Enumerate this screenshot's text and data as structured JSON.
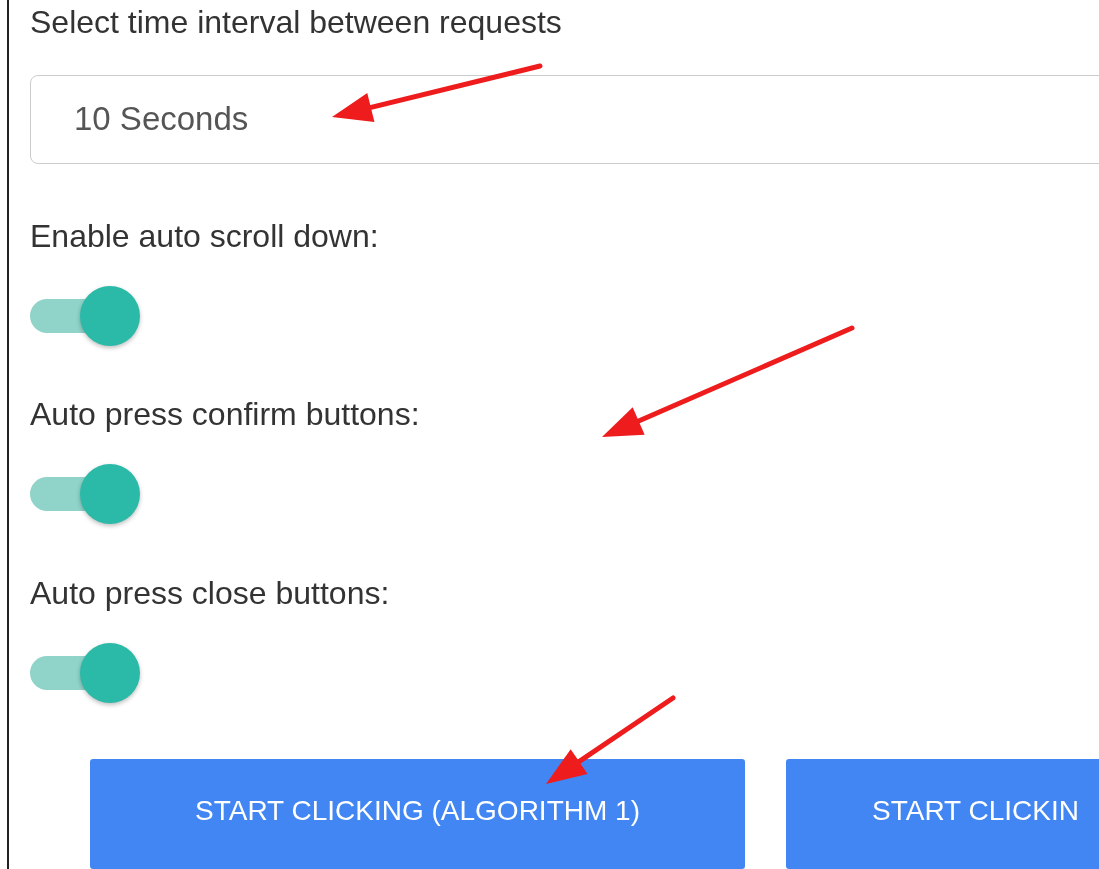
{
  "interval": {
    "label": "Select time interval between requests",
    "value": "10 Seconds"
  },
  "settings": [
    {
      "label": "Enable auto scroll down:",
      "on": true
    },
    {
      "label": "Auto press confirm buttons:",
      "on": true
    },
    {
      "label": "Auto press close buttons:",
      "on": true
    }
  ],
  "buttons": [
    "START CLICKING (ALGORITHM 1)",
    "START CLICKIN"
  ]
}
